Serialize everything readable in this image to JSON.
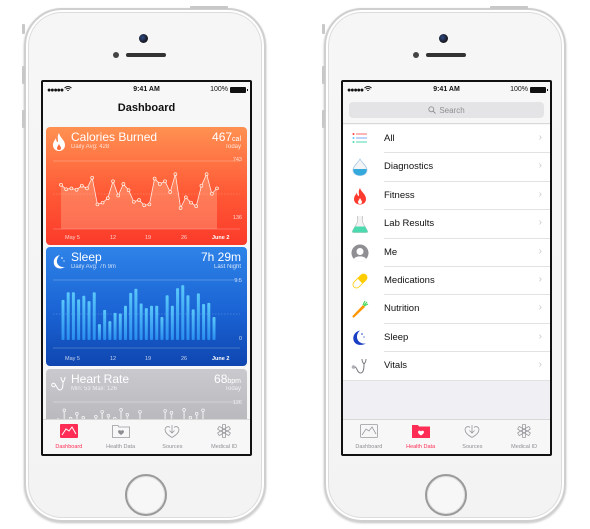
{
  "status_bar": {
    "signal": "●●●●●",
    "wifi": "wifi-icon",
    "time": "9:41 AM",
    "battery": "100%"
  },
  "dashboard_screen": {
    "title": "Dashboard",
    "cards": {
      "calories": {
        "title": "Calories Burned",
        "subtitle": "Daily Avg: 428",
        "value": "467",
        "unit": "cal",
        "when": "Today",
        "color": "#ff5a36",
        "icon": "flame-icon"
      },
      "sleep": {
        "title": "Sleep",
        "subtitle": "Daily Avg: 7h 9m",
        "value": "7h 29m",
        "when": "Last Night",
        "color": "#1a63d4",
        "icon": "moon-icon"
      },
      "heart_rate": {
        "title": "Heart Rate",
        "subtitle": "Min: 53 Max: 126",
        "value": "68",
        "unit": "bpm",
        "when": "Today",
        "color": "#b6b6bb",
        "icon": "stethoscope-icon",
        "ymax_label": "126"
      }
    }
  },
  "health_data_screen": {
    "search_placeholder": "Search",
    "categories": [
      {
        "label": "All",
        "icon": "list-icon"
      },
      {
        "label": "Diagnostics",
        "icon": "water-drop-icon"
      },
      {
        "label": "Fitness",
        "icon": "flame-icon"
      },
      {
        "label": "Lab Results",
        "icon": "flask-icon"
      },
      {
        "label": "Me",
        "icon": "person-icon"
      },
      {
        "label": "Medications",
        "icon": "pill-icon"
      },
      {
        "label": "Nutrition",
        "icon": "carrot-icon"
      },
      {
        "label": "Sleep",
        "icon": "moon-icon"
      },
      {
        "label": "Vitals",
        "icon": "stethoscope-icon"
      }
    ],
    "chevron": "›"
  },
  "tab_bar": {
    "tabs": [
      {
        "label": "Dashboard",
        "icon": "dashboard-chart-icon"
      },
      {
        "label": "Health Data",
        "icon": "heart-folder-icon"
      },
      {
        "label": "Sources",
        "icon": "heart-download-icon"
      },
      {
        "label": "Medical ID",
        "icon": "medical-star-icon"
      }
    ],
    "active_color": "#ff2d55",
    "inactive_color": "#8e8e93"
  },
  "chart_data": [
    {
      "type": "line",
      "title": "Calories Burned",
      "x_tick_labels": [
        "May 5",
        "12",
        "19",
        "26",
        "June 2"
      ],
      "y_labels": [
        "743",
        "136"
      ],
      "ylim": [
        136,
        743
      ],
      "grid": true,
      "values": [
        520,
        470,
        480,
        465,
        510,
        480,
        600,
        300,
        320,
        370,
        560,
        400,
        530,
        460,
        330,
        350,
        290,
        300,
        590,
        530,
        560,
        440,
        640,
        260,
        380,
        320,
        280,
        510,
        640,
        420,
        480
      ]
    },
    {
      "type": "bar",
      "title": "Sleep",
      "x_tick_labels": [
        "May 5",
        "12",
        "19",
        "26",
        "June 2"
      ],
      "y_labels": [
        "9.5",
        "0"
      ],
      "ylim": [
        0,
        9.5
      ],
      "grid": true,
      "values": [
        6.8,
        8.1,
        8.1,
        6.9,
        7.5,
        6.6,
        8.1,
        2.7,
        5.1,
        3.2,
        4.6,
        4.5,
        5.8,
        8.0,
        8.7,
        6.2,
        5.4,
        5.8,
        5.8,
        3.9,
        7.6,
        5.8,
        8.8,
        9.3,
        7.6,
        5.2,
        7.9,
        6.1,
        6.3,
        3.9
      ]
    },
    {
      "type": "scatter",
      "title": "Heart Rate",
      "y_labels": [
        "126"
      ],
      "ylim": [
        53,
        126
      ],
      "grid": true,
      "values": [
        75,
        95,
        78,
        88,
        80,
        65,
        82,
        92,
        84,
        78,
        96,
        86,
        60,
        92,
        72,
        62,
        70,
        94,
        90,
        66,
        96,
        80,
        88,
        95
      ]
    }
  ]
}
